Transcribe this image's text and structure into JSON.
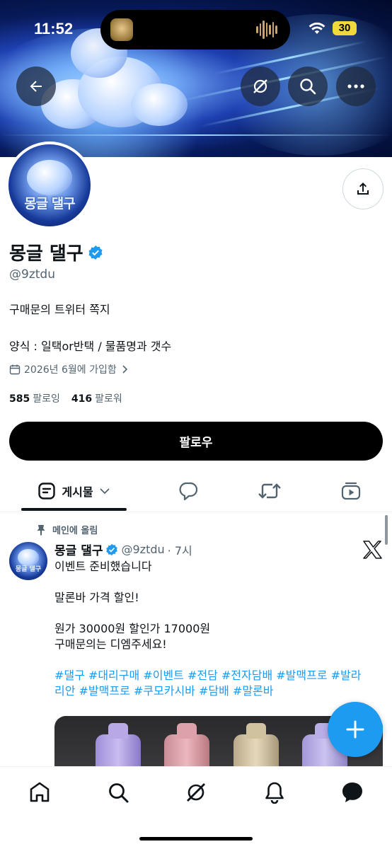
{
  "status_bar": {
    "time": "11:52",
    "battery": "30"
  },
  "header": {
    "back_icon": "arrow-left-icon",
    "grok_icon": "grok-icon",
    "search_icon": "search-icon",
    "more_icon": "more-horizontal-icon"
  },
  "profile": {
    "avatar_text": "몽글 댈구",
    "name": "몽글 댈구",
    "verified": true,
    "handle": "@9ztdu",
    "bio_line1": "구매문의 트위터 쪽지",
    "bio_line2": "양식 : 일택or반택 / 물품명과 갯수",
    "joined": "2026년 6월에 가입함",
    "following_count": "585",
    "following_label": "팔로잉",
    "followers_count": "416",
    "followers_label": "팔로워",
    "follow_button": "팔로우"
  },
  "tabs": [
    {
      "label": "게시물",
      "icon": "posts-icon",
      "active": true
    },
    {
      "label": "",
      "icon": "reply-icon",
      "active": false
    },
    {
      "label": "",
      "icon": "repost-icon",
      "active": false
    },
    {
      "label": "",
      "icon": "media-icon",
      "active": false
    }
  ],
  "pinned_post": {
    "pinned_label": "메인에 올림",
    "author_name": "몽글 댈구",
    "author_handle": "@9ztdu",
    "time": "· 7시",
    "lines": [
      "이벤트 준비했습니다",
      "",
      "말론바 가격 할인!",
      "",
      "원가 30000원 할인가 17000원",
      "구매문의는 디엠주세요!",
      ""
    ],
    "hashtags": "#댈구 #대리구매 #이벤트 #전담 #전자담배 #발맥프로 #발라리안 #발맥프로 #쿠모카시바 #담배 #말론바"
  },
  "bottom_nav": [
    "home-icon",
    "search-icon",
    "grok-icon",
    "notifications-icon",
    "messages-icon"
  ],
  "colors": {
    "accent": "#1d9bf0",
    "text": "#0f1419",
    "muted": "#536471",
    "button": "#000000"
  }
}
